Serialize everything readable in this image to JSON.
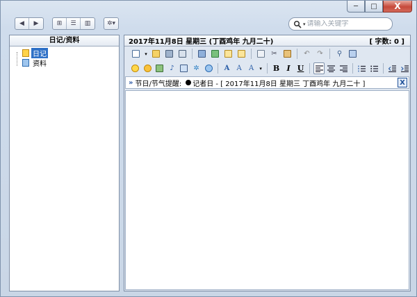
{
  "window": {
    "caption": {
      "minimize": "─",
      "maximize": "□",
      "close": "X"
    }
  },
  "toolbar": {
    "back": "◀",
    "forward": "▶",
    "views": [
      "⊞",
      "☰",
      "▥"
    ],
    "settings": "✲▾",
    "search": {
      "placeholder": "请输入关键字"
    }
  },
  "left_panel": {
    "title": "日记/资料",
    "items": [
      {
        "label": "日记",
        "selected": true,
        "icon": "diary-book-icon"
      },
      {
        "label": "资料",
        "selected": false,
        "icon": "doc-icon"
      }
    ]
  },
  "right_panel": {
    "date_header": "2017年11月8日  星期三  (丁酉鸡年  九月二十)",
    "word_count": "[ 字数: 0 ]",
    "reminder": {
      "chevron": "»",
      "label": "节日/节气提醒:",
      "event": "记者日 - [ 2017年11月8日  星期三  丁酉鸡年  九月二十 ]",
      "close": "X"
    },
    "format": {
      "bold": "B",
      "italic": "I",
      "underline": "U"
    }
  },
  "colors": {
    "accent": "#2f71c7",
    "frame": "#c9d6e6",
    "close": "#c6493a"
  }
}
